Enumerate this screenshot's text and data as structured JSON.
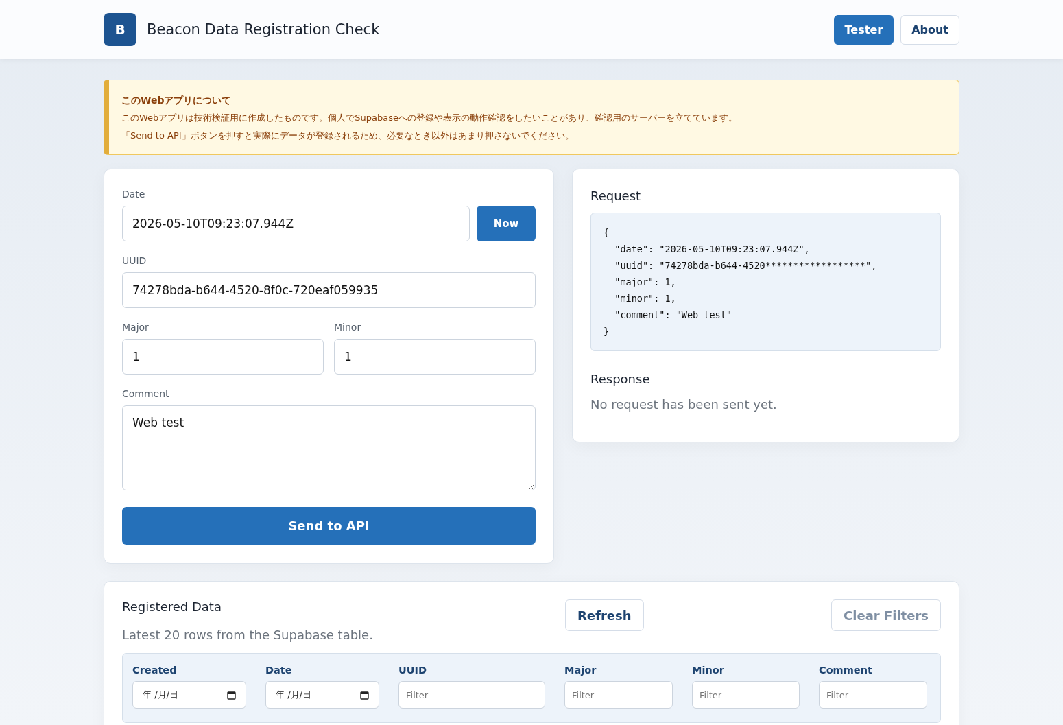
{
  "header": {
    "logo": "B",
    "title": "Beacon Data Registration Check",
    "nav": [
      {
        "label": "Tester",
        "selected": true
      },
      {
        "label": "About",
        "selected": false
      }
    ]
  },
  "notice": {
    "title": "このWebアプリについて",
    "lines": [
      "このWebアプリは技術検証用に作成したものです。個人でSupabaseへの登録や表示の動作確認をしたいことがあり、確認用のサーバーを立てています。",
      "「Send to API」ボタンを押すと実際にデータが登録されるため、必要なとき以外はあまり押さないでください。"
    ]
  },
  "form": {
    "date": {
      "label": "Date",
      "value": "2026-05-10T09:23:07.944Z",
      "button": "Now"
    },
    "uuid": {
      "label": "UUID",
      "value": "74278bda-b644-4520-8f0c-720eaf059935"
    },
    "major": {
      "label": "Major",
      "value": "1"
    },
    "minor": {
      "label": "Minor",
      "value": "1"
    },
    "comment": {
      "label": "Comment",
      "value": "Web test"
    },
    "submit": "Send to API"
  },
  "request": {
    "title": "Request",
    "lines": [
      "{",
      "  \"date\": \"2026-05-10T09:23:07.944Z\",",
      "  \"uuid\": \"74278bda-b644-4520******************\",",
      "  \"major\": 1,",
      "  \"minor\": 1,",
      "  \"comment\": \"Web test\"",
      "}"
    ]
  },
  "response": {
    "title": "Response",
    "message": "No request has been sent yet."
  },
  "registered": {
    "title": "Registered Data",
    "subtitle": "Latest 20 rows from the Supabase table.",
    "refresh": "Refresh",
    "clear": "Clear Filters",
    "filters": [
      {
        "label": "Created",
        "kind": "date",
        "placeholder": "年 /月/日"
      },
      {
        "label": "Date",
        "kind": "date",
        "placeholder": "年 /月/日"
      },
      {
        "label": "UUID",
        "kind": "text",
        "placeholder": "Filter"
      },
      {
        "label": "Major",
        "kind": "text",
        "placeholder": "Filter"
      },
      {
        "label": "Minor",
        "kind": "text",
        "placeholder": "Filter"
      },
      {
        "label": "Comment",
        "kind": "text",
        "placeholder": "Filter"
      }
    ]
  }
}
